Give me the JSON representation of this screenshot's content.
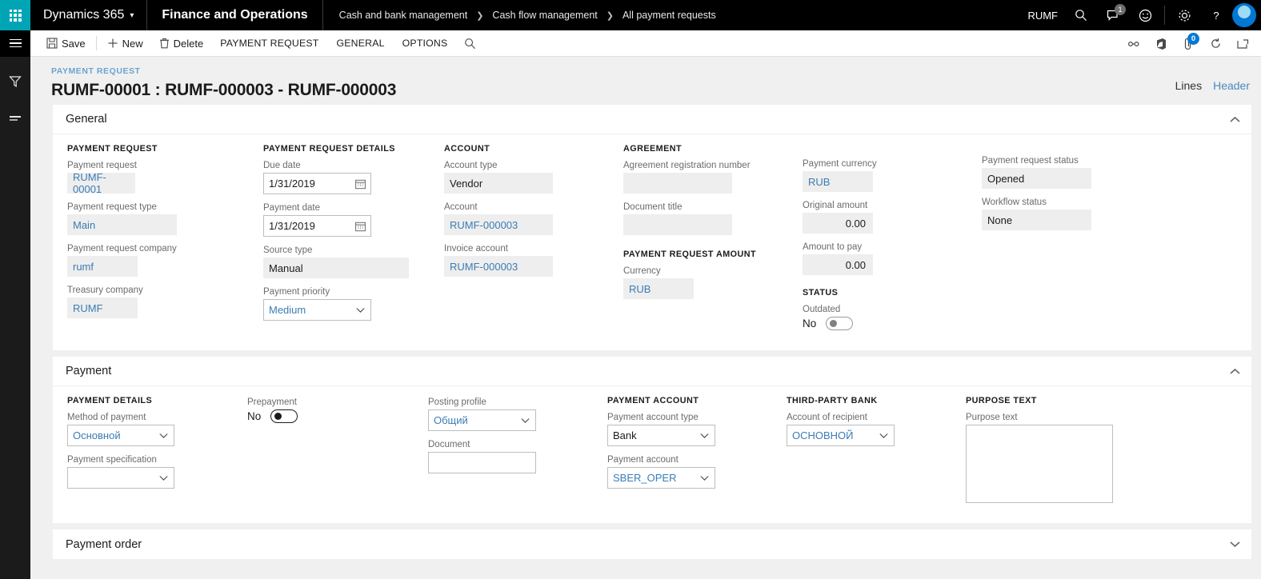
{
  "topbar": {
    "brand": "Dynamics 365",
    "app_name": "Finance and Operations",
    "breadcrumbs": [
      "Cash and bank management",
      "Cash flow management",
      "All payment requests"
    ],
    "company": "RUMF",
    "notification_count": "1",
    "icons": [
      "search-icon",
      "notifications-icon",
      "feedback-icon",
      "settings-icon",
      "help-icon",
      "avatar"
    ]
  },
  "commandbar": {
    "save_label": "Save",
    "new_label": "New",
    "delete_label": "Delete",
    "tabs": [
      "PAYMENT REQUEST",
      "GENERAL",
      "OPTIONS"
    ],
    "attachment_count": "0"
  },
  "page": {
    "kicker": "PAYMENT REQUEST",
    "title": "RUMF-00001 : RUMF-000003 - RUMF-000003",
    "view_lines": "Lines",
    "view_header": "Header"
  },
  "sections": {
    "general": {
      "title": "General",
      "expanded": true
    },
    "payment": {
      "title": "Payment",
      "expanded": true
    },
    "payment_order": {
      "title": "Payment order",
      "expanded": false
    }
  },
  "general": {
    "col1": {
      "group": "PAYMENT REQUEST",
      "fields": [
        {
          "label": "Payment request",
          "value": "RUMF-00001"
        },
        {
          "label": "Payment request type",
          "value": "Main"
        },
        {
          "label": "Payment request company",
          "value": "rumf"
        },
        {
          "label": "Treasury company",
          "value": "RUMF"
        }
      ]
    },
    "col2": {
      "group": "PAYMENT REQUEST DETAILS",
      "due_date_label": "Due date",
      "due_date_value": "1/31/2019",
      "payment_date_label": "Payment date",
      "payment_date_value": "1/31/2019",
      "source_type_label": "Source type",
      "source_type_value": "Manual",
      "payment_priority_label": "Payment priority",
      "payment_priority_value": "Medium"
    },
    "col3": {
      "group": "ACCOUNT",
      "account_type_label": "Account type",
      "account_type_value": "Vendor",
      "account_label": "Account",
      "account_value": "RUMF-000003",
      "invoice_account_label": "Invoice account",
      "invoice_account_value": "RUMF-000003"
    },
    "col4": {
      "group": "AGREEMENT",
      "agreement_number_label": "Agreement registration number",
      "agreement_number_value": "",
      "document_title_label": "Document title",
      "document_title_value": "",
      "amount_group": "PAYMENT REQUEST AMOUNT",
      "currency_label": "Currency",
      "currency_value": "RUB"
    },
    "col5": {
      "payment_currency_label": "Payment currency",
      "payment_currency_value": "RUB",
      "original_amount_label": "Original amount",
      "original_amount_value": "0.00",
      "amount_to_pay_label": "Amount to pay",
      "amount_to_pay_value": "0.00",
      "status_group": "STATUS",
      "outdated_label": "Outdated",
      "outdated_value": "No"
    },
    "col6": {
      "status_label": "Payment request status",
      "status_value": "Opened",
      "workflow_label": "Workflow status",
      "workflow_value": "None"
    }
  },
  "payment": {
    "col1": {
      "group": "PAYMENT DETAILS",
      "method_label": "Method of payment",
      "method_value": "Основной",
      "specification_label": "Payment specification",
      "specification_value": ""
    },
    "col2": {
      "prepayment_label": "Prepayment",
      "prepayment_value": "No"
    },
    "col3": {
      "posting_profile_label": "Posting profile",
      "posting_profile_value": "Общий",
      "document_label": "Document",
      "document_value": ""
    },
    "col4": {
      "group": "PAYMENT ACCOUNT",
      "account_type_label": "Payment account type",
      "account_type_value": "Bank",
      "account_label": "Payment account",
      "account_value": "SBER_OPER"
    },
    "col5": {
      "group": "THIRD-PARTY BANK",
      "recipient_label": "Account of recipient",
      "recipient_value": "ОСНОВНОЙ"
    },
    "col6": {
      "group": "PURPOSE TEXT",
      "purpose_label": "Purpose text",
      "purpose_value": ""
    }
  },
  "colors": {
    "accent_teal": "#00a5b5",
    "link_blue": "#3b7cb5",
    "badge_blue": "#0078d4",
    "topbar_black": "#000000"
  }
}
